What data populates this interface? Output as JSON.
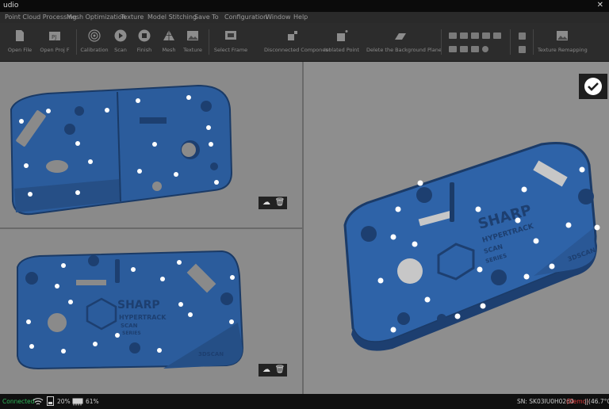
{
  "window": {
    "title": "udio",
    "close_glyph": "✕"
  },
  "menu": [
    "Point Cloud Processing",
    "Mesh Optimization",
    "Texture",
    "Model Stitching",
    "Save To",
    "Configuration",
    "Window",
    "Help"
  ],
  "toolbar": [
    {
      "label": "Open File",
      "icon": "open-file-icon"
    },
    {
      "label": "Open Proj F",
      "icon": "open-project-icon"
    },
    {
      "label": "Calibration",
      "icon": "calibration-icon"
    },
    {
      "label": "Scan",
      "icon": "scan-play-icon"
    },
    {
      "label": "Finish",
      "icon": "finish-stop-icon"
    },
    {
      "label": "Mesh",
      "icon": "mesh-icon"
    },
    {
      "label": "Texture",
      "icon": "texture-icon"
    },
    {
      "label": "Select Frame",
      "icon": "select-frame-icon"
    },
    {
      "label": "Disconnected Component",
      "icon": "disconnected-component-icon"
    },
    {
      "label": "Isolated Point",
      "icon": "isolated-point-icon"
    },
    {
      "label": "Delete the Background Plane",
      "icon": "delete-background-plane-icon"
    },
    {
      "label": "Texture Remapping",
      "icon": "texture-remapping-icon"
    }
  ],
  "status": {
    "connection": "Connected",
    "storage": "20%",
    "memory": "61%",
    "sn_prefix": "SN: SK03IU0H0260",
    "demo": "(Demo)",
    "temp": "||(46.7°C)",
    "connection_color": "#2fb85a",
    "demo_color": "#e03a3a"
  },
  "colors": {
    "model_blue": "#2e63a8",
    "model_dark": "#1d3f70"
  }
}
